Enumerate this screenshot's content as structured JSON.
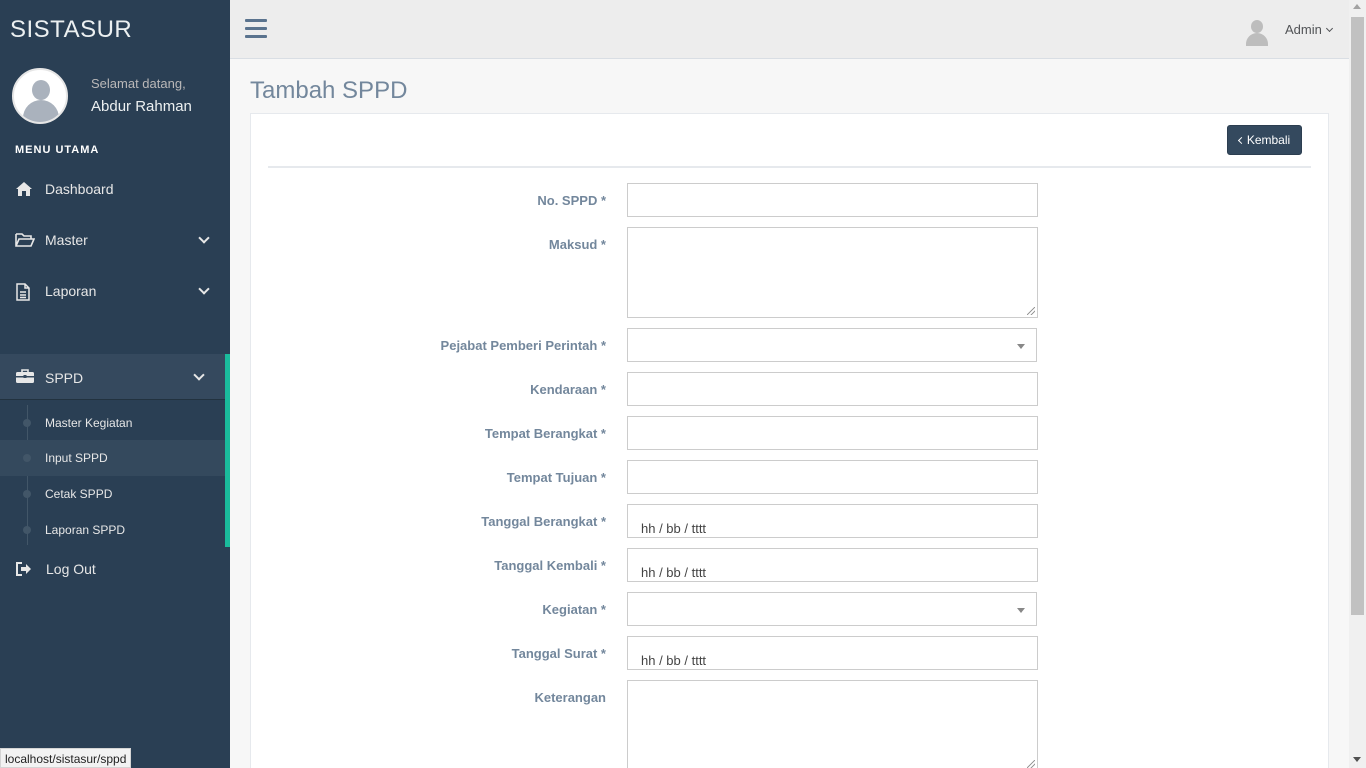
{
  "sidebar": {
    "brand": "SISTASUR",
    "welcome": "Selamat datang,",
    "user_name": "Abdur Rahman",
    "menu_title": "MENU UTAMA",
    "items": [
      {
        "label": "Dashboard",
        "icon": "home-icon"
      },
      {
        "label": "Master",
        "icon": "folder-open-icon"
      },
      {
        "label": "Laporan",
        "icon": "file-text-icon"
      },
      {
        "label": "SPPD",
        "icon": "briefcase-icon"
      },
      {
        "label": "Log Out",
        "icon": "sign-out-icon"
      }
    ],
    "sppd_submenu": [
      {
        "label": "Master Kegiatan"
      },
      {
        "label": "Input SPPD"
      },
      {
        "label": "Cetak SPPD"
      },
      {
        "label": "Laporan SPPD"
      }
    ]
  },
  "topbar": {
    "user_label": "Admin"
  },
  "page": {
    "title": "Tambah SPPD",
    "back_button": "Kembali"
  },
  "form": {
    "no_sppd": {
      "label": "No. SPPD *",
      "value": ""
    },
    "maksud": {
      "label": "Maksud *",
      "value": ""
    },
    "pejabat": {
      "label": "Pejabat Pemberi Perintah *",
      "value": ""
    },
    "kendaraan": {
      "label": "Kendaraan *",
      "value": ""
    },
    "tempat_berangkat": {
      "label": "Tempat Berangkat *",
      "value": ""
    },
    "tempat_tujuan": {
      "label": "Tempat Tujuan *",
      "value": ""
    },
    "tanggal_berangkat": {
      "label": "Tanggal Berangkat *",
      "placeholder": "hh / bb / tttt"
    },
    "tanggal_kembali": {
      "label": "Tanggal Kembali *",
      "placeholder": "hh / bb / tttt"
    },
    "kegiatan": {
      "label": "Kegiatan *",
      "value": ""
    },
    "tanggal_surat": {
      "label": "Tanggal Surat *",
      "placeholder": "hh / bb / tttt"
    },
    "keterangan": {
      "label": "Keterangan",
      "value": ""
    }
  },
  "status_bar": {
    "url": "localhost/sistasur/sppd"
  },
  "colors": {
    "sidebar": "#2a3f54",
    "accent": "#1abb9c",
    "button": "#34495e",
    "label": "#73879c"
  }
}
